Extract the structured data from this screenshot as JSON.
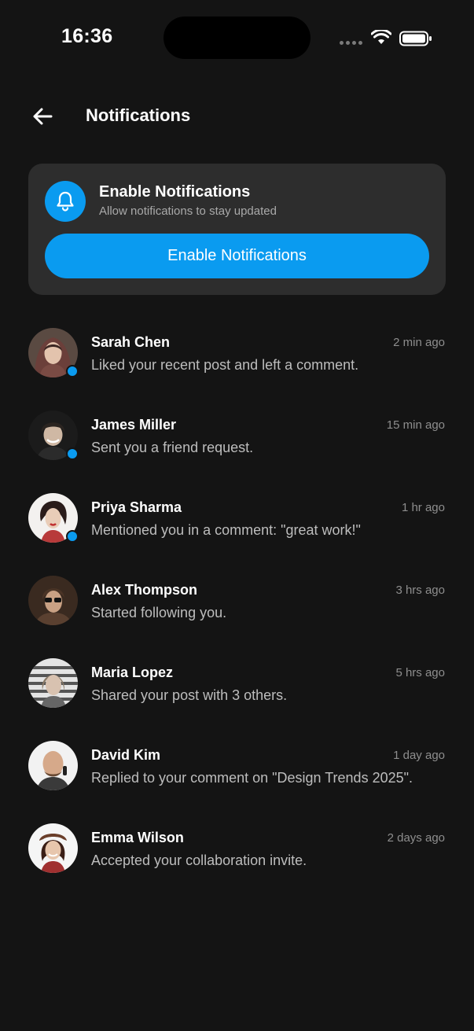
{
  "status_bar": {
    "time": "16:36"
  },
  "header": {
    "title": "Notifications",
    "back_icon": "arrow-left-icon"
  },
  "enable_card": {
    "icon": "bell-icon",
    "title": "Enable Notifications",
    "subtitle": "Allow notifications to stay updated",
    "button_label": "Enable Notifications"
  },
  "colors": {
    "background": "#141414",
    "card": "#2d2d2d",
    "accent": "#0a9bf0",
    "muted_text": "#bdbdbd"
  },
  "notifications": [
    {
      "name": "Sarah Chen",
      "time": "2 min ago",
      "message": "Liked your recent post and left a comment.",
      "unread": true
    },
    {
      "name": "James Miller",
      "time": "15 min ago",
      "message": "Sent you a friend request.",
      "unread": true
    },
    {
      "name": "Priya Sharma",
      "time": "1 hr ago",
      "message": "Mentioned you in a comment: \"great work!\"",
      "unread": true
    },
    {
      "name": "Alex Thompson",
      "time": "3 hrs ago",
      "message": "Started following you.",
      "unread": false
    },
    {
      "name": "Maria Lopez",
      "time": "5 hrs ago",
      "message": "Shared your post with 3 others.",
      "unread": false
    },
    {
      "name": "David Kim",
      "time": "1 day ago",
      "message": "Replied to your comment on \"Design Trends 2025\".",
      "unread": false
    },
    {
      "name": "Emma Wilson",
      "time": "2 days ago",
      "message": "Accepted your collaboration invite.",
      "unread": false
    }
  ]
}
